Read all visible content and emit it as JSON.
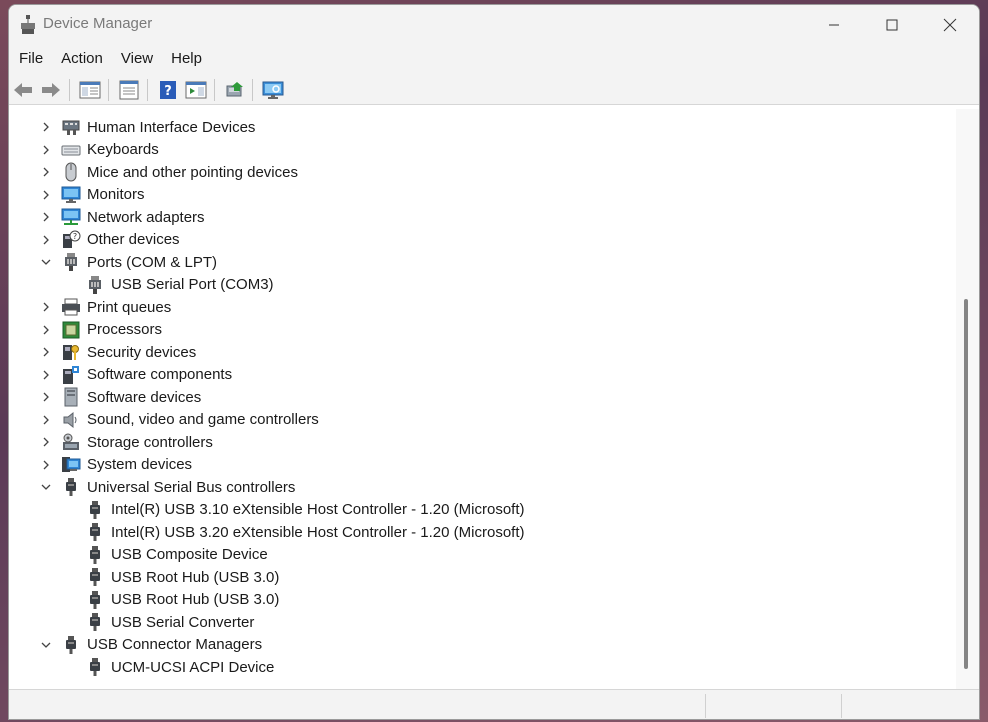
{
  "window": {
    "title": "Device Manager"
  },
  "menu": [
    "File",
    "Action",
    "View",
    "Help"
  ],
  "toolbar_icons": [
    "back-icon",
    "forward-icon",
    "show-hide-console-tree-icon",
    "properties-icon",
    "help-icon",
    "action-pane-icon",
    "update-driver-icon",
    "scan-hardware-icon"
  ],
  "tree": [
    {
      "label": "Human Interface Devices",
      "expanded": false,
      "level": 0,
      "icon": "hid-icon"
    },
    {
      "label": "Keyboards",
      "expanded": false,
      "level": 0,
      "icon": "keyboard-icon"
    },
    {
      "label": "Mice and other pointing devices",
      "expanded": false,
      "level": 0,
      "icon": "mouse-icon"
    },
    {
      "label": "Monitors",
      "expanded": false,
      "level": 0,
      "icon": "monitor-icon"
    },
    {
      "label": "Network adapters",
      "expanded": false,
      "level": 0,
      "icon": "network-icon"
    },
    {
      "label": "Other devices",
      "expanded": false,
      "level": 0,
      "icon": "unknown-device-icon"
    },
    {
      "label": "Ports (COM & LPT)",
      "expanded": true,
      "level": 0,
      "icon": "port-icon"
    },
    {
      "label": "USB Serial Port (COM3)",
      "level": 1,
      "icon": "port-icon"
    },
    {
      "label": "Print queues",
      "expanded": false,
      "level": 0,
      "icon": "printer-icon"
    },
    {
      "label": "Processors",
      "expanded": false,
      "level": 0,
      "icon": "processor-icon"
    },
    {
      "label": "Security devices",
      "expanded": false,
      "level": 0,
      "icon": "security-icon"
    },
    {
      "label": "Software components",
      "expanded": false,
      "level": 0,
      "icon": "software-component-icon"
    },
    {
      "label": "Software devices",
      "expanded": false,
      "level": 0,
      "icon": "software-device-icon"
    },
    {
      "label": "Sound, video and game controllers",
      "expanded": false,
      "level": 0,
      "icon": "speaker-icon"
    },
    {
      "label": "Storage controllers",
      "expanded": false,
      "level": 0,
      "icon": "storage-icon"
    },
    {
      "label": "System devices",
      "expanded": false,
      "level": 0,
      "icon": "system-icon"
    },
    {
      "label": "Universal Serial Bus controllers",
      "expanded": true,
      "level": 0,
      "icon": "usb-icon"
    },
    {
      "label": "Intel(R) USB 3.10 eXtensible Host Controller - 1.20 (Microsoft)",
      "level": 1,
      "icon": "usb-icon"
    },
    {
      "label": "Intel(R) USB 3.20 eXtensible Host Controller - 1.20 (Microsoft)",
      "level": 1,
      "icon": "usb-icon"
    },
    {
      "label": "USB Composite Device",
      "level": 1,
      "icon": "usb-icon"
    },
    {
      "label": "USB Root Hub (USB 3.0)",
      "level": 1,
      "icon": "usb-icon"
    },
    {
      "label": "USB Root Hub (USB 3.0)",
      "level": 1,
      "icon": "usb-icon"
    },
    {
      "label": "USB Serial Converter",
      "level": 1,
      "icon": "usb-icon"
    },
    {
      "label": "USB Connector Managers",
      "expanded": true,
      "level": 0,
      "icon": "usb-icon"
    },
    {
      "label": "UCM-UCSI ACPI Device",
      "level": 1,
      "icon": "usb-icon"
    }
  ]
}
